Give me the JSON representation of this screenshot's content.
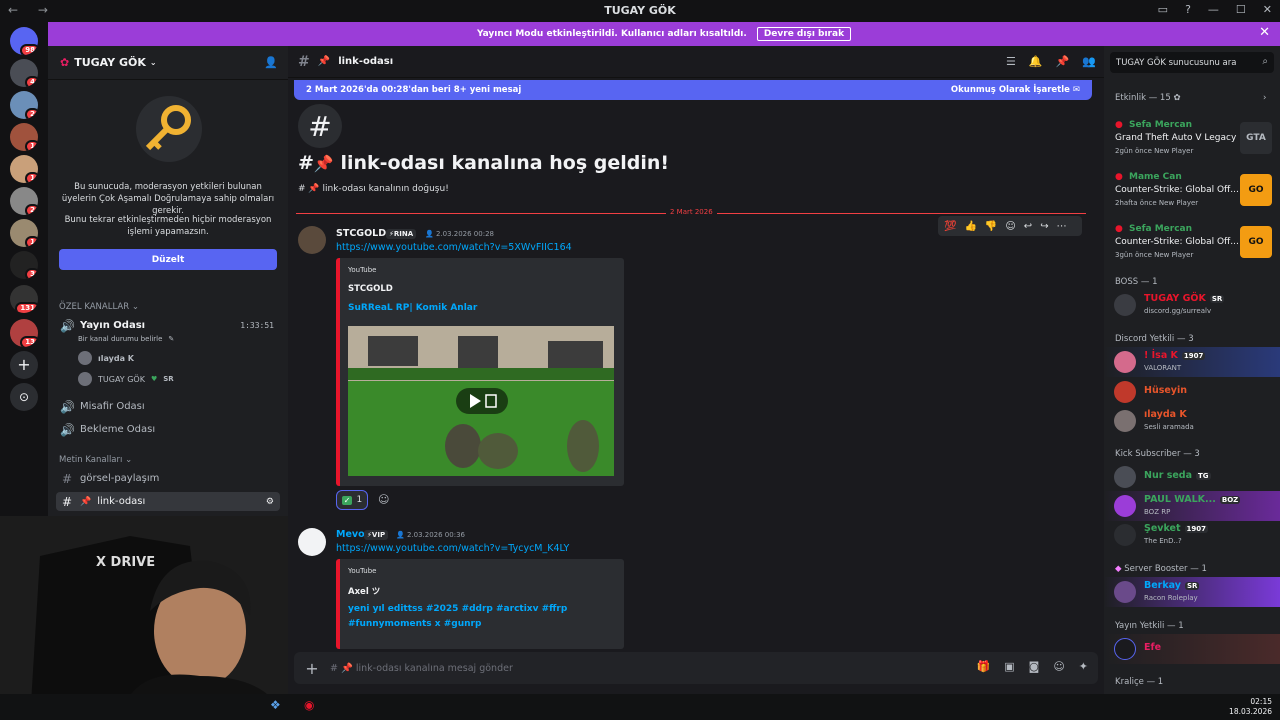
{
  "window": {
    "title": "TUGAY GÖK",
    "nav": "← →",
    "controls": [
      "▭",
      "?",
      "—",
      "☐",
      "✕"
    ]
  },
  "banner": {
    "text": "Yayıncı Modu etkinleştirildi. Kullanıcı adları kısaltıldı.",
    "button": "Devre dışı bırak",
    "close": "✕"
  },
  "servers": {
    "badges": [
      "98",
      "4",
      "2",
      "1",
      "1",
      "2",
      "1",
      "3",
      "131",
      "13"
    ]
  },
  "sidebar": {
    "server_name": "TUGAY GÖK",
    "mod_warning": "Bu sunucuda, moderasyon yetkileri bulunan üyelerin Çok Aşamalı Doğrulamaya sahip olmaları gerekir.",
    "mod_warning2": "Bunu tekrar etkinleştirmeden hiçbir moderasyon işlemi yapamazsın.",
    "fix_button": "Düzelt",
    "cat_private": "ÖZEL KANALLAR",
    "voice1": "Yayın Odası",
    "voice1_timer": "1:33:51",
    "voice1_status": "Bir kanal durumu belirle",
    "voice1_user1": "ılayda K",
    "voice1_user2": "TUGAY GÖK",
    "voice1_user2_tag": "SR",
    "voice2": "Misafir Odası",
    "voice3": "Bekleme Odası",
    "cat_text": "Metin Kanalları",
    "text1": "görsel-paylaşım",
    "text2": "link-odası"
  },
  "main": {
    "channel": "link-odası",
    "new_messages": "2 Mart 2026'da 00:28'dan beri 8+ yeni mesaj",
    "mark_read": "Okunmuş Olarak İşaretle",
    "welcome_title": "link-odası kanalına hoş geldin!",
    "welcome_sub": "link-odası kanalının doğuşu!",
    "date_divider": "2 Mart 2026",
    "msg1": {
      "user": "STCGOLD",
      "tag": "RINA",
      "time": "2.03.2026 00:28",
      "link": "https://www.youtube.com/watch?v=5XWvFIIC164",
      "provider": "YouTube",
      "author": "STCGOLD",
      "title": "SuRReaL RP| Komik Anlar",
      "reaction_count": "1"
    },
    "msg2": {
      "user": "Mevo",
      "tag": "VIP",
      "time": "2.03.2026 00:36",
      "link": "https://www.youtube.com/watch?v=TycycM_K4LY",
      "provider": "YouTube",
      "author": "Axel ツ",
      "title": "yeni yıl edittss #2025  #ddrp #arctixv #ffrp #funnymoments x #gunrp"
    },
    "composer_placeholder": "link-odası kanalına mesaj gönder"
  },
  "members": {
    "search_placeholder": "TUGAY GÖK sunucusunu ara",
    "activity_header": "Etkinlik — 15",
    "games": [
      {
        "user": "Sefa Mercan",
        "game": "Grand Theft Auto V Legacy",
        "meta": "2gün önce  New Player",
        "icon": "GTA"
      },
      {
        "user": "Mame Can",
        "game": "Counter-Strike: Global Off...",
        "meta": "2hafta önce  New Player",
        "icon": "GO"
      },
      {
        "user": "Sefa Mercan",
        "game": "Counter-Strike: Global Off...",
        "meta": "3gün önce  New Player",
        "icon": "GO"
      }
    ],
    "groups": [
      {
        "header": "BOSS — 1",
        "items": [
          {
            "name": "TUGAY GÖK",
            "badge": "SR",
            "sub": "discord.gg/surrealv",
            "color": "#e8152b"
          }
        ]
      },
      {
        "header": "Discord Yetkili — 3",
        "items": [
          {
            "name": "! İsa K",
            "badge": "1907",
            "sub": "VALORANT",
            "color": "#e8152b"
          },
          {
            "name": "Hüseyin",
            "badge": "",
            "sub": "",
            "color": "#e8152b"
          },
          {
            "name": "ılayda K",
            "badge": "",
            "sub": "Sesli aramada",
            "color": "#e8152b"
          }
        ]
      },
      {
        "header": "Kick Subscriber — 3",
        "items": [
          {
            "name": "Nur seda",
            "badge": "TG",
            "sub": "",
            "color": "#3ba55d"
          },
          {
            "name": "PAUL WALK...",
            "badge": "BOZ",
            "sub": "BOZ RP",
            "color": "#3ba55d"
          },
          {
            "name": "Şevket",
            "badge": "1907",
            "sub": "The EnD..?",
            "color": "#3ba55d"
          }
        ]
      },
      {
        "header": "Server Booster — 1",
        "items": [
          {
            "name": "Berkay",
            "badge": "SR",
            "sub": "Racon Roleplay",
            "color": "#00a8fc"
          }
        ]
      },
      {
        "header": "Yayın Yetkili — 1",
        "items": [
          {
            "name": "Efe",
            "badge": "",
            "sub": "",
            "color": "#e91e63"
          }
        ]
      },
      {
        "header": "Kraliçe — 1",
        "items": []
      }
    ]
  },
  "taskbar": {
    "time": "02:15",
    "date": "18.03.2026"
  }
}
